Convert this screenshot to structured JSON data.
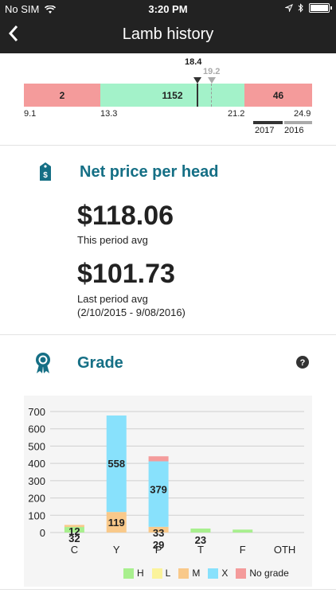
{
  "status_bar": {
    "carrier": "No SIM",
    "time": "3:20 PM"
  },
  "nav": {
    "back_icon": "chevron-left-icon",
    "title": "Lamb history"
  },
  "range_bar": {
    "segments": [
      {
        "label": "2",
        "color": "#f49b9b"
      },
      {
        "label": "1152",
        "color": "#a3f2c9"
      },
      {
        "label": "46",
        "color": "#f49b9b"
      }
    ],
    "ticks": [
      "9.1",
      "13.3",
      "21.2",
      "24.9"
    ],
    "marker_current": {
      "value": "18.4",
      "year": "2017",
      "color": "#333333"
    },
    "marker_previous": {
      "value": "19.2",
      "year": "2016",
      "color": "#aaaaaa"
    }
  },
  "net_price": {
    "icon": "price-tag-icon",
    "title": "Net price per head",
    "this_value": "$118.06",
    "this_label": "This period avg",
    "last_value": "$101.73",
    "last_label": "Last period avg",
    "last_range": "(2/10/2015 - 9/08/2016)"
  },
  "grade": {
    "icon": "award-ribbon-icon",
    "title": "Grade",
    "help_icon": "help-icon"
  },
  "chart_data": {
    "type": "bar",
    "stacked": true,
    "categories": [
      "C",
      "Y",
      "P",
      "T",
      "F",
      "OTH"
    ],
    "ylim": [
      0,
      700
    ],
    "yticks": [
      0,
      100,
      200,
      300,
      400,
      500,
      600,
      700
    ],
    "grid": true,
    "legend_position": "bottom-right",
    "series": [
      {
        "name": "H",
        "color": "#a8ef8e",
        "values": [
          32,
          0,
          0,
          23,
          17,
          0
        ]
      },
      {
        "name": "L",
        "color": "#fbf39b",
        "values": [
          0,
          0,
          0,
          0,
          0,
          0
        ]
      },
      {
        "name": "M",
        "color": "#f9c98a",
        "values": [
          12,
          119,
          33,
          0,
          0,
          0
        ]
      },
      {
        "name": "X",
        "color": "#88e1fc",
        "values": [
          0,
          558,
          379,
          0,
          0,
          0
        ]
      },
      {
        "name": "No grade",
        "color": "#f49b9b",
        "values": [
          0,
          0,
          29,
          0,
          0,
          0
        ]
      }
    ],
    "data_labels": [
      {
        "category": "C",
        "text": "12"
      },
      {
        "category": "C",
        "text": "32"
      },
      {
        "category": "Y",
        "text": "119"
      },
      {
        "category": "Y",
        "text": "558"
      },
      {
        "category": "P",
        "text": "33"
      },
      {
        "category": "P",
        "text": "29"
      },
      {
        "category": "P",
        "text": "379"
      },
      {
        "category": "T",
        "text": "23"
      }
    ]
  }
}
